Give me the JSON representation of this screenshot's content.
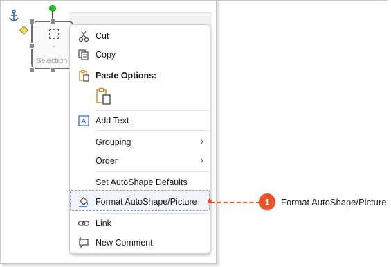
{
  "shape": {
    "label": "Selection"
  },
  "menu": {
    "items": {
      "cut": "Cut",
      "copy": "Copy",
      "paste_options": "Paste Options:",
      "add_text": "Add Text",
      "grouping": "Grouping",
      "order": "Order",
      "set_defaults": "Set AutoShape Defaults",
      "format": "Format AutoShape/Picture",
      "link": "Link",
      "new_comment": "New Comment"
    }
  },
  "callout": {
    "number": "1",
    "label": "Format AutoShape/Picture"
  },
  "colors": {
    "accent": "#e8532a",
    "highlight_border": "#8b9bcf",
    "rotation_handle": "#21c521"
  },
  "icons": [
    "anchor-icon",
    "scissors-icon",
    "copy-icon",
    "clipboard-icon",
    "text-box-icon",
    "paint-bucket-icon",
    "link-icon",
    "comment-icon",
    "chevron-right-icon"
  ]
}
